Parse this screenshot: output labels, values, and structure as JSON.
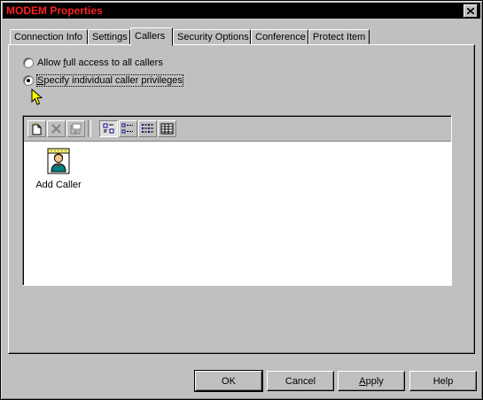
{
  "window": {
    "title": "MODEM Properties",
    "close_glyph": "✕"
  },
  "tabs": [
    {
      "label": "Connection Info"
    },
    {
      "label": "Settings"
    },
    {
      "label": "Callers",
      "active": true
    },
    {
      "label": "Security Options"
    },
    {
      "label": "Conference"
    },
    {
      "label": "Protect Item"
    }
  ],
  "callers": {
    "option_all": {
      "prefix": "Allow ",
      "accel": "f",
      "rest": "ull access to all callers",
      "selected": false
    },
    "option_specific": {
      "prefix": "",
      "accel": "S",
      "rest": "pecify individual caller privileges",
      "selected": true
    }
  },
  "toolbar": {
    "icons": [
      "new-caller-icon",
      "delete-icon",
      "properties-icon",
      "large-icons-view-icon",
      "small-icons-view-icon",
      "list-view-icon",
      "details-view-icon"
    ]
  },
  "list": {
    "items": [
      {
        "label": "Add Caller",
        "icon": "add-caller-icon"
      }
    ]
  },
  "buttons": {
    "ok": "OK",
    "cancel": "Cancel",
    "apply_accel": "A",
    "apply_rest": "pply",
    "help": "Help"
  },
  "colors": {
    "face": "#c0c0c0",
    "title_bg": "#000000",
    "title_text": "#ff2020",
    "cursor": "#ffff00"
  }
}
